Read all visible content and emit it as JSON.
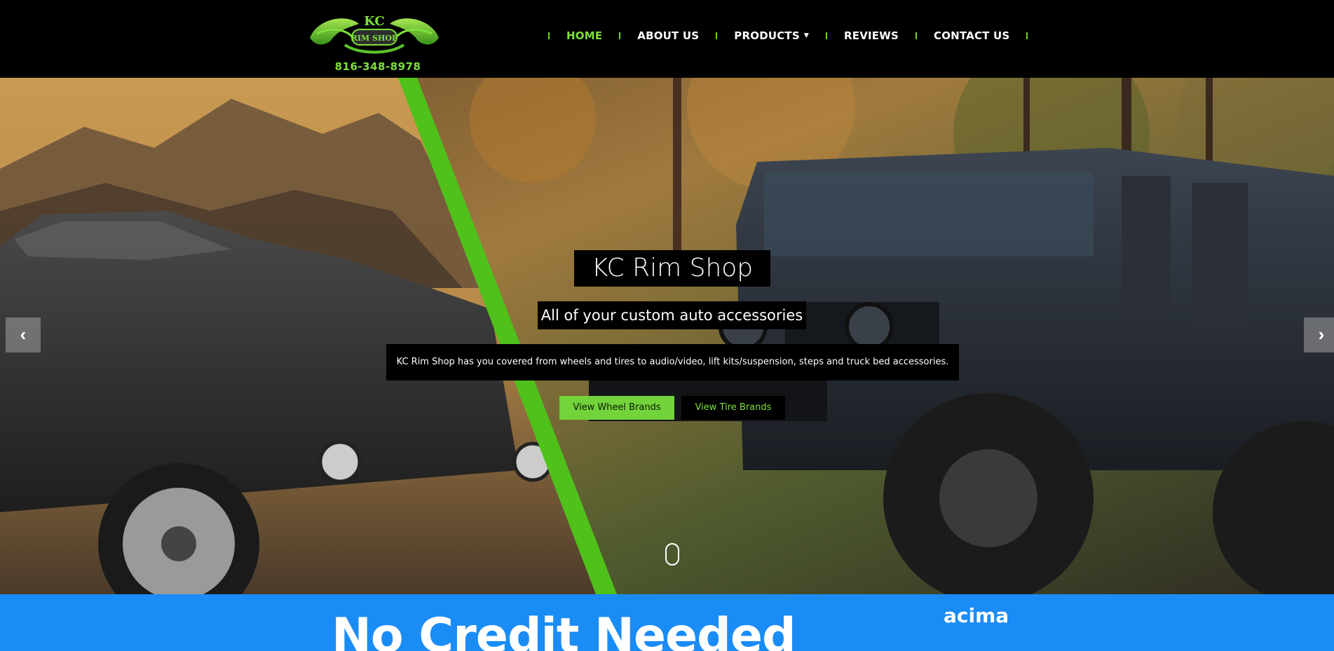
{
  "header": {
    "logo_alt": "KC Rim Shop",
    "phone": "816-348-8978"
  },
  "nav": {
    "items": [
      {
        "label": "HOME",
        "active": true
      },
      {
        "label": "ABOUT US"
      },
      {
        "label": "PRODUCTS",
        "has_dropdown": true
      },
      {
        "label": "REVIEWS"
      },
      {
        "label": "CONTACT US"
      }
    ]
  },
  "hero": {
    "title": "KC Rim Shop",
    "subtitle": "All of your custom auto accessories",
    "description": "KC Rim Shop has you covered from wheels and tires to audio/video, lift kits/suspension, steps and truck bed accessories.",
    "buttons": {
      "wheels": "View Wheel Brands",
      "tires": "View Tire Brands"
    },
    "prev_arrow": "‹",
    "next_arrow": "›"
  },
  "banner": {
    "title": "No Credit Needed",
    "brand": "acima"
  },
  "colors": {
    "accent_green": "#7ee03a",
    "banner_blue": "#1a8cf6",
    "header_bg": "#000000"
  }
}
